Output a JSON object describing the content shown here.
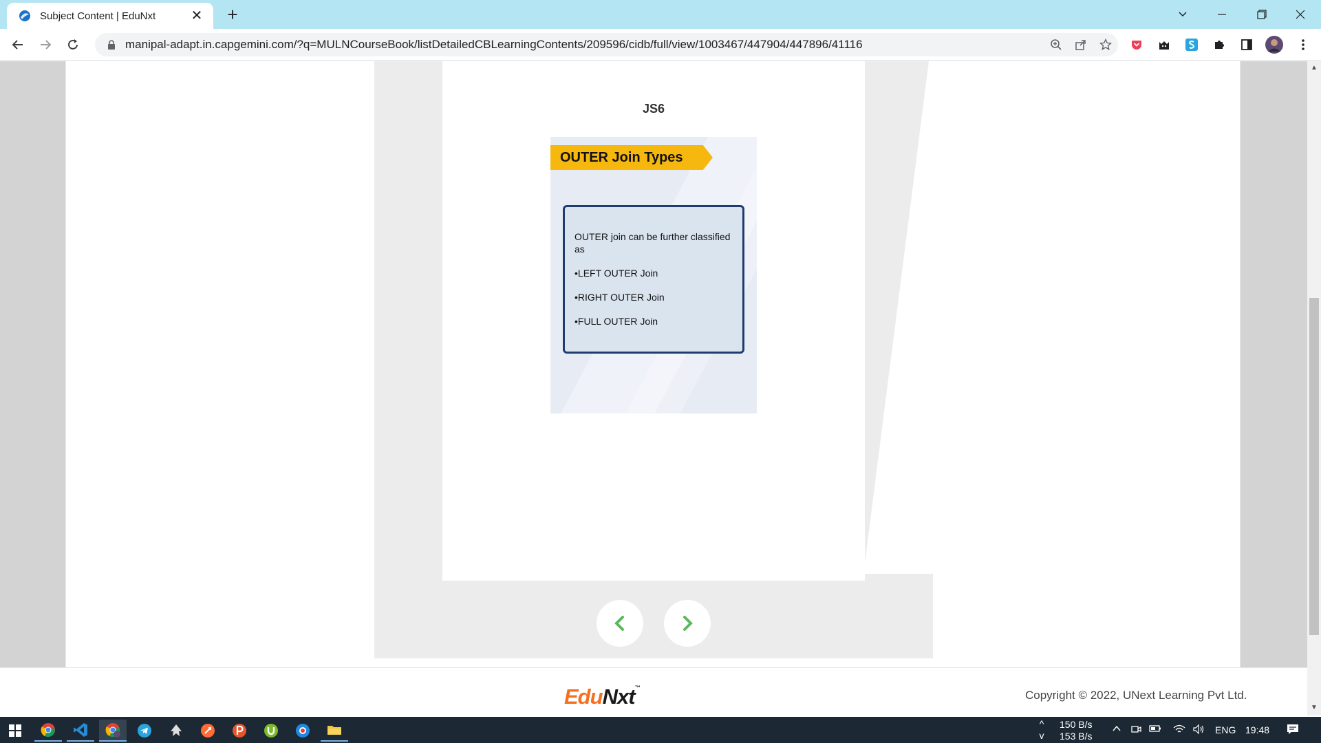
{
  "browser": {
    "tab_title": "Subject Content | EduNxt",
    "url": "manipal-adapt.in.capgemini.com/?q=MULNCourseBook/listDetailedCBLearningContents/209596/cidb/full/view/1003467/447904/447896/41116"
  },
  "viewer": {
    "slide_heading": "JS6",
    "slide": {
      "banner": "OUTER Join Types",
      "intro": "OUTER join can be further classified as",
      "items": [
        "•LEFT OUTER Join",
        "•RIGHT OUTER Join",
        "•FULL OUTER Join"
      ]
    }
  },
  "footer": {
    "logo_edu": "Edu",
    "logo_nxt": "Nxt",
    "logo_tm": "™",
    "copyright": "Copyright © 2022, UNext Learning Pvt Ltd."
  },
  "taskbar": {
    "upload_speed": "150 B/s",
    "download_speed": "153 B/s",
    "language": "ENG",
    "clock": "19:48"
  },
  "colors": {
    "tabbar": "#b3e5f2",
    "banner": "#f6b70e",
    "textbox_border": "#1f3c6e",
    "nav_arrow": "#5cb85c",
    "logo_orange": "#f37021"
  }
}
